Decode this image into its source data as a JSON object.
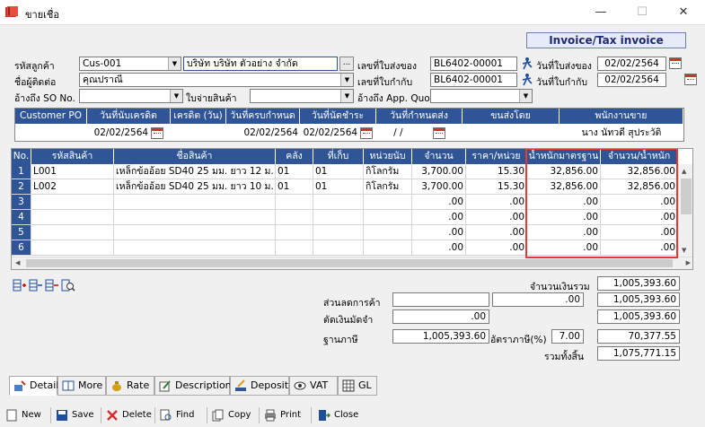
{
  "window": {
    "title": "ขายเชื่อ",
    "minimize": "—",
    "maximize": "☐",
    "close": "✕"
  },
  "header": {
    "invoice_title": "Invoice/Tax invoice",
    "customer_code_label": "รหัสลูกค้า",
    "customer_code": "Cus-001",
    "customer_name": "บริษัท บริษัท ตัวอย่าง จำกัด",
    "browse_label": "...",
    "contact_label": "ชื่อผู้ติดต่อ",
    "contact_value": "คุณปราณี",
    "so_ref_label": "อ้างถึง SO No.",
    "so_ref_value": "",
    "delivery_label": "ใบจ่ายสินค้า",
    "delivery_value": "",
    "delivery_no_label": "เลขที่ใบส่งของ",
    "delivery_no": "BL6402-00001",
    "tax_invoice_no_label": "เลขที่ใบกำกับ",
    "tax_invoice_no": "BL6402-00001",
    "app_quo_label": "อ้างถึง App. Quo.",
    "app_quo_value": "",
    "delivery_date_label": "วันที่ใบส่งของ",
    "delivery_date": "02/02/2564",
    "tax_date_label": "วันที่ใบกำกับ",
    "tax_date": "02/02/2564"
  },
  "info_table": {
    "headers": [
      "Customer PO",
      "วันที่นับเครดิต",
      "เครดิต (วัน)",
      "วันที่ครบกำหนด",
      "วันที่นัดชำระ",
      "วันที่กำหนดส่ง",
      "ขนส่งโดย",
      "พนักงานขาย"
    ],
    "values": [
      "",
      "02/02/2564",
      "",
      "02/02/2564",
      "02/02/2564",
      "/  /",
      "",
      "นาง นัทวดี สุประวัติ"
    ]
  },
  "grid": {
    "headers": [
      "No.",
      "รหัสสินค้า",
      "ชื่อสินค้า",
      "คลัง",
      "ที่เก็บ",
      "หน่วยนับ",
      "จำนวน",
      "ราคา/หน่วย",
      "น้ำหนักมาตรฐาน",
      "จำนวน/น้ำหนัก"
    ],
    "rows": [
      {
        "no": "1",
        "code": "L001",
        "name": "เหล็กข้ออ้อย SD40 25 มม. ยาว 12 ม.",
        "wh": "01",
        "loc": "01",
        "unit": "กิโลกรัม",
        "qty": "3,700.00",
        "price": "15.30",
        "std_weight": "32,856.00",
        "qty_weight": "32,856.00"
      },
      {
        "no": "2",
        "code": "L002",
        "name": "เหล็กข้ออ้อย SD40 25 มม. ยาว 10 ม.",
        "wh": "01",
        "loc": "01",
        "unit": "กิโลกรัม",
        "qty": "3,700.00",
        "price": "15.30",
        "std_weight": "32,856.00",
        "qty_weight": "32,856.00"
      },
      {
        "no": "3",
        "code": "",
        "name": "",
        "wh": "",
        "loc": "",
        "unit": "",
        "qty": ".00",
        "price": ".00",
        "std_weight": ".00",
        "qty_weight": ".00"
      },
      {
        "no": "4",
        "code": "",
        "name": "",
        "wh": "",
        "loc": "",
        "unit": "",
        "qty": ".00",
        "price": ".00",
        "std_weight": ".00",
        "qty_weight": ".00"
      },
      {
        "no": "5",
        "code": "",
        "name": "",
        "wh": "",
        "loc": "",
        "unit": "",
        "qty": ".00",
        "price": ".00",
        "std_weight": ".00",
        "qty_weight": ".00"
      },
      {
        "no": "6",
        "code": "",
        "name": "",
        "wh": "",
        "loc": "",
        "unit": "",
        "qty": ".00",
        "price": ".00",
        "std_weight": ".00",
        "qty_weight": ".00"
      }
    ]
  },
  "totals": {
    "total_label": "จำนวนเงินรวม",
    "total": "1,005,393.60",
    "discount_label": "ส่วนลดการค้า",
    "discount_text": "",
    "discount": ".00",
    "discount_total": "1,005,393.60",
    "deposit_label": "ตัดเงินมัดจำ",
    "deposit": ".00",
    "after_deposit": "1,005,393.60",
    "tax_base_label": "ฐานภาษี",
    "tax_base": "1,005,393.60",
    "vat_rate_label": "อัตราภาษี(%)",
    "vat_rate": "7.00",
    "vat_amount": "70,377.55",
    "grand_total_label": "รวมทั้งสิ้น",
    "grand_total": "1,075,771.15"
  },
  "tabs": [
    "Detail",
    "More",
    "Rate",
    "Description",
    "Deposit",
    "VAT",
    "GL"
  ],
  "toolbar": [
    "New",
    "Save",
    "Delete",
    "Find",
    "Copy",
    "Print",
    "Close"
  ],
  "colors": {
    "header_blue": "#2f5597",
    "highlight_red": "#e53935"
  }
}
